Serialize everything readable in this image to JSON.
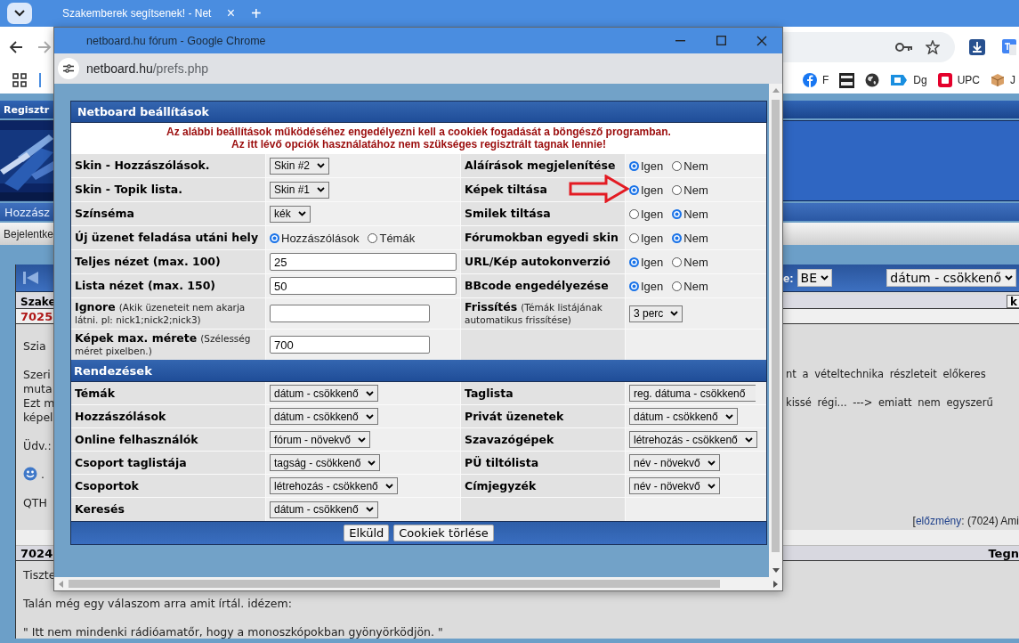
{
  "browser": {
    "tab": {
      "title": "Szakemberek segítsenek! - Net",
      "close": "×"
    },
    "new_tab": "+",
    "bookmarks": [
      {
        "kind": "facebook",
        "label": "F"
      },
      {
        "kind": "oscam"
      },
      {
        "kind": "globe"
      },
      {
        "kind": "dg",
        "label": "Dg"
      },
      {
        "kind": "upc",
        "label": "UPC"
      },
      {
        "kind": "box",
        "label": "J"
      }
    ]
  },
  "page": {
    "header_bar": "Regisztr",
    "nav_bar": "Hozzász",
    "login_bar": "Bejelentke",
    "toolbar": {
      "label": "e:",
      "selects": [
        "BE",
        "dátum - csökkenő"
      ]
    },
    "thread_header": {
      "title": "Szake",
      "button": "k"
    },
    "posts": [
      {
        "number": "7025",
        "new": true,
        "paragraphs": [
          {
            "lines": [
              {
                "kind": "split",
                "left": "Szia"
              }
            ]
          },
          {
            "lines": [
              {
                "kind": "split",
                "left": "Szeri",
                "right": "nt a vételtechnika részleteit előkeres"
              },
              {
                "kind": "split",
                "left": "muta"
              },
              {
                "kind": "split",
                "left": "Ezt m",
                "right": "kissé régi... ---> emiatt nem egyszerű"
              },
              {
                "kind": "split",
                "left": "képel"
              }
            ]
          },
          {
            "lines": [
              {
                "kind": "split",
                "left": "Üdv.:"
              }
            ]
          },
          {
            "lines": [
              {
                "kind": "smileys",
                "separator": "."
              }
            ]
          },
          {
            "lines": [
              {
                "kind": "split",
                "left": "QTH"
              }
            ]
          }
        ],
        "reply_ref": {
          "open": "[",
          "link": "előzmény",
          "rest": ": (7024) Ami"
        }
      },
      {
        "number": "7024",
        "new": false,
        "date": "Tegn",
        "paragraphs": [
          {
            "lines": [
              {
                "kind": "split",
                "left": "Tiszte"
              }
            ]
          },
          {
            "lines": [
              {
                "kind": "full",
                "text": "Talán még egy válaszom arra amit írtál. idézem:"
              }
            ]
          },
          {
            "lines": [
              {
                "kind": "full",
                "text": "\" Itt nem mindenki rádióamatőr, hogy a monoszkópokban gyönyörködjön. \""
              }
            ]
          }
        ]
      }
    ]
  },
  "popup": {
    "title": "netboard.hu fórum - Google Chrome",
    "url_host": "netboard.hu",
    "url_path": "/prefs.php",
    "panel_title": "Netboard beállítások",
    "notice": [
      "Az alábbi beállítások működéséhez engedélyezni kell a cookiek fogadását a böngésző programban.",
      "Az itt lévő opciók használatához nem szükséges regisztrált tagnak lennie!"
    ],
    "settings": [
      {
        "left": {
          "label": "Skin - Hozzászólások.",
          "kind": "select",
          "value": "Skin #2"
        },
        "right": {
          "label": "Aláírások megjelenítése",
          "kind": "radio",
          "options": [
            {
              "label": "Igen",
              "selected": true
            },
            {
              "label": "Nem",
              "selected": false
            }
          ]
        }
      },
      {
        "left": {
          "label": "Skin - Topik lista.",
          "kind": "select",
          "value": "Skin #1"
        },
        "right": {
          "label": "Képek tiltása",
          "kind": "radio",
          "highlighted": true,
          "options": [
            {
              "label": "Igen",
              "selected": true
            },
            {
              "label": "Nem",
              "selected": false
            }
          ]
        }
      },
      {
        "left": {
          "label": "Színséma",
          "kind": "select",
          "value": "kék"
        },
        "right": {
          "label": "Smilek tiltása",
          "kind": "radio",
          "options": [
            {
              "label": "Igen",
              "selected": false
            },
            {
              "label": "Nem",
              "selected": true
            }
          ]
        }
      },
      {
        "left": {
          "label": "Új üzenet feladása utáni hely",
          "kind": "radio",
          "options": [
            {
              "label": "Hozzászólások",
              "selected": true
            },
            {
              "label": "Témák",
              "selected": false
            }
          ]
        },
        "right": {
          "label": "Fórumokban egyedi skin",
          "kind": "radio",
          "options": [
            {
              "label": "Igen",
              "selected": false
            },
            {
              "label": "Nem",
              "selected": true
            }
          ]
        }
      },
      {
        "left": {
          "label": "Teljes nézet (max. 100)",
          "kind": "text",
          "value": "25"
        },
        "right": {
          "label": "URL/Kép autokonverzió",
          "kind": "radio",
          "options": [
            {
              "label": "Igen",
              "selected": true
            },
            {
              "label": "Nem",
              "selected": false
            }
          ]
        }
      },
      {
        "left": {
          "label": "Lista nézet (max. 150)",
          "kind": "text",
          "value": "50"
        },
        "right": {
          "label": "BBcode engedélyezése",
          "kind": "radio",
          "options": [
            {
              "label": "Igen",
              "selected": true
            },
            {
              "label": "Nem",
              "selected": false
            }
          ]
        }
      },
      {
        "left": {
          "label": "Ignore",
          "hint": "(Akik üzeneteit nem akarja látni. pl: nick1;nick2;nick3)",
          "kind": "text"
        },
        "right": {
          "label": "Frissítés",
          "hint": "(Témák listájának automatikus frissítése)",
          "kind": "select",
          "value": "3 perc"
        }
      },
      {
        "left": {
          "label": "Képek max. mérete",
          "hint": "(Szélesség méret pixelben.)",
          "kind": "text",
          "value": "700"
        }
      }
    ],
    "sort_title": "Rendezések",
    "sorts": [
      {
        "left": {
          "label": "Témák",
          "value": "dátum - csökkenő"
        },
        "right": {
          "label": "Taglista",
          "value": "reg. dátuma - csökkenő",
          "clipped": true
        }
      },
      {
        "left": {
          "label": "Hozzászólások",
          "value": "dátum - csökkenő"
        },
        "right": {
          "label": "Privát üzenetek",
          "value": "dátum - csökkenő"
        }
      },
      {
        "left": {
          "label": "Online felhasználók",
          "value": "fórum - növekvő"
        },
        "right": {
          "label": "Szavazógépek",
          "value": "létrehozás - csökkenő"
        }
      },
      {
        "left": {
          "label": "Csoport taglistája",
          "value": "tagság - csökkenő"
        },
        "right": {
          "label": "PÜ tiltólista",
          "value": "név - növekvő"
        }
      },
      {
        "left": {
          "label": "Csoportok",
          "value": "létrehozás - csökkenő"
        },
        "right": {
          "label": "Címjegyzék",
          "value": "név - növekvő"
        }
      },
      {
        "left": {
          "label": "Keresés",
          "value": "dátum - csökkenő"
        }
      }
    ],
    "buttons": [
      "Elküld",
      "Cookiek törlése"
    ]
  }
}
